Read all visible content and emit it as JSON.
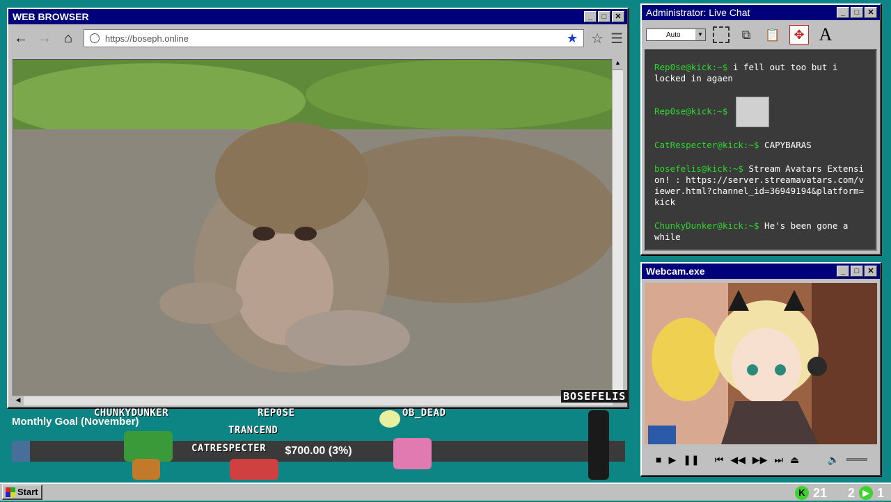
{
  "browser": {
    "title": "WEB BROWSER",
    "url": "https://boseph.online",
    "streamer_tag": "BOSEFELIS"
  },
  "chat": {
    "title": "Administrator: Live Chat",
    "dropdown_value": "Auto",
    "messages": [
      {
        "user": "Rep0se@kick:~$",
        "text": "i fell out too but i locked in agaen"
      },
      {
        "user": "Rep0se@kick:~$",
        "text": ""
      },
      {
        "user": "CatRespecter@kick:~$",
        "text": "CAPYBARAS"
      },
      {
        "user": "bosefelis@kick:~$",
        "text": "Stream Avatars Extension! : https://server.streamavatars.com/viewer.html?channel_id=36949194&platform=kick"
      },
      {
        "user": "ChunkyDunker@kick:~$",
        "text": "He's been gone a while"
      }
    ]
  },
  "webcam": {
    "title": "Webcam.exe"
  },
  "overlay": {
    "goal_title": "Monthly Goal (November)",
    "goal_text": "$700.00 (3%)",
    "goal_progress": 0.03,
    "avatars": [
      "CHUNKYDUNKER",
      "REP0SE",
      "OB_DEAD",
      "TRANCEND",
      "CATRESPECTER"
    ]
  },
  "taskbar": {
    "start_label": "Start",
    "tray_count_1": "21",
    "tray_count_2": "2",
    "tray_count_3": "1"
  },
  "colors": {
    "desktop": "#0d8585",
    "titlebar": "#00007a",
    "chat_user": "#2fd62f",
    "kick_green": "#3ed12f"
  }
}
